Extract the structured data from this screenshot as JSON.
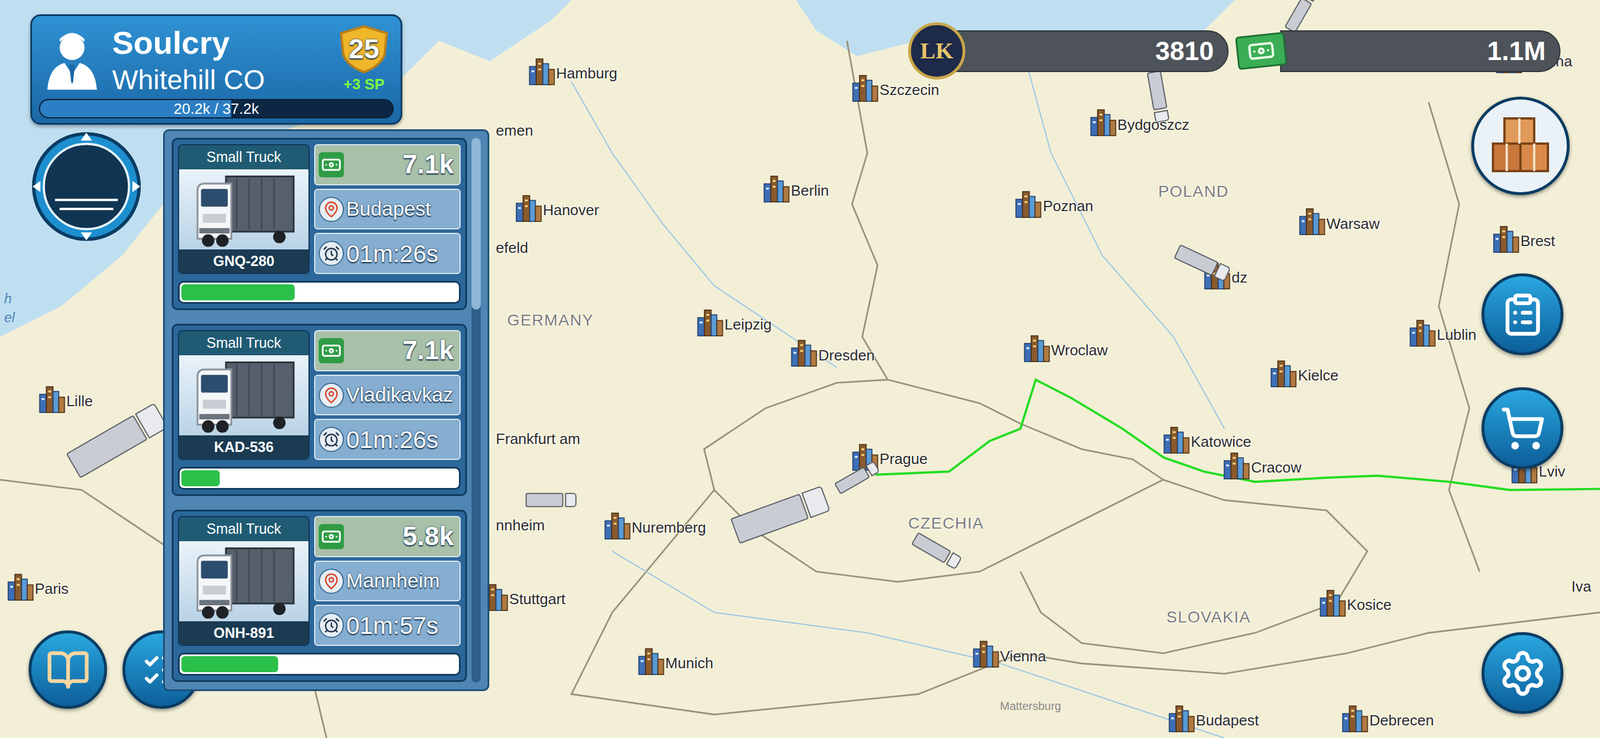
{
  "player": {
    "name": "Soulcry",
    "company": "Whitehill CO",
    "level": "25",
    "skill_points": "+3 SP",
    "xp": {
      "reading": "20.2k / 37.2k",
      "level": 0.543
    }
  },
  "currency": {
    "coin_label": "LK",
    "coins": "3810",
    "cash": "1.1M"
  },
  "trucks": [
    {
      "type": "Small Truck",
      "plate": "GNQ-280",
      "reward": "7.1k",
      "destination": "Budapest",
      "time": "01m:26s",
      "level": 0.41
    },
    {
      "type": "Small Truck",
      "plate": "KAD-536",
      "reward": "7.1k",
      "destination": "Vladikavkaz",
      "time": "01m:26s",
      "level": 0.14
    },
    {
      "type": "Small Truck",
      "plate": "ONH-891",
      "reward": "5.8k",
      "destination": "Mannheim",
      "time": "01m:57s",
      "level": 0.35
    }
  ],
  "map": {
    "countries": [
      "GERMANY",
      "POLAND",
      "CZECHIA",
      "SLOVAKIA"
    ],
    "cities": [
      "Hamburg",
      "Szczecin",
      "emen",
      "Bydgoszcz",
      "Berlin",
      "Poznan",
      "Hanover",
      "efeld",
      "Warsaw",
      "dz",
      "Brest",
      "Leipzig",
      "Dresden",
      "Wroclaw",
      "Lublin",
      "Kielce",
      "Frankfurt am",
      "Lille",
      "Prague",
      "Katowice",
      "Cracow",
      "nnheim",
      "Nuremberg",
      "Paris",
      "Stuttgart",
      "Kosice",
      "Munich",
      "Vienna",
      "Budapest",
      "Debrecen",
      "Hrodna",
      "Lviv",
      "Iva"
    ],
    "minor_labels": [
      "Mattersburg"
    ],
    "water_labels": [
      "h",
      "el"
    ]
  }
}
